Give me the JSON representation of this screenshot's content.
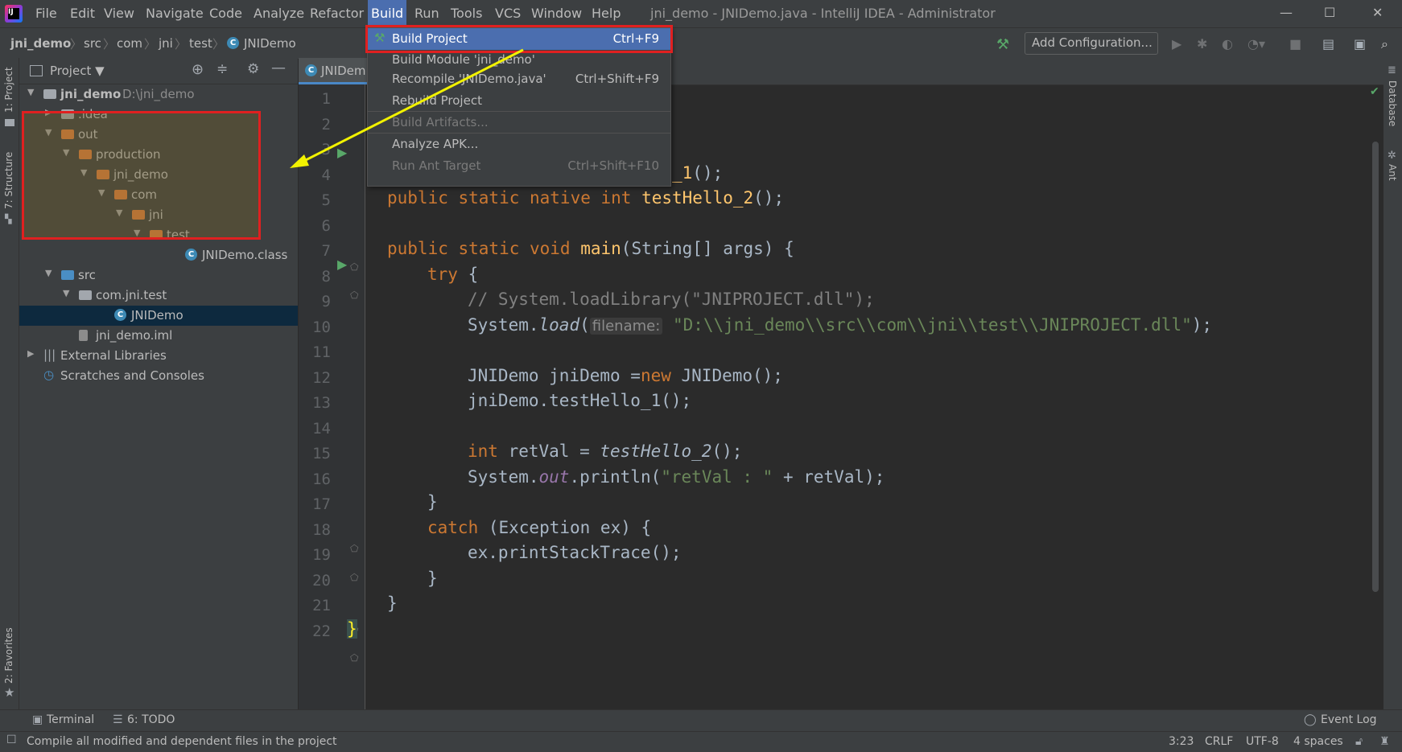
{
  "titlebar": {
    "app_icon": "intellij-icon",
    "menus": [
      "File",
      "Edit",
      "View",
      "Navigate",
      "Code",
      "Analyze",
      "Refactor",
      "Build",
      "Run",
      "Tools",
      "VCS",
      "Window",
      "Help"
    ],
    "active_menu": "Build",
    "title": "jni_demo - JNIDemo.java - IntelliJ IDEA - Administrator",
    "controls": [
      "—",
      "☐",
      "✕"
    ]
  },
  "navbar": {
    "breadcrumbs": [
      "jni_demo",
      "src",
      "com",
      "jni",
      "test",
      "JNIDemo"
    ],
    "add_configuration": "Add Configuration..."
  },
  "left_strip": {
    "project_tab": "1: Project",
    "structure_tab": "7: Structure",
    "favorites_tab": "2: Favorites"
  },
  "right_strip": {
    "database_tab": "Database",
    "ant_tab": "Ant"
  },
  "project_panel": {
    "header": "Project ▼",
    "tree": [
      {
        "label": "jni_demo",
        "extra": "D:\\jni_demo",
        "indent": 0,
        "arrow": "▼",
        "icon": "module",
        "bold": true
      },
      {
        "label": ".idea",
        "indent": 1,
        "arrow": "▶",
        "icon": "folder-gray"
      },
      {
        "label": "out",
        "indent": 1,
        "arrow": "▼",
        "icon": "folder-orange"
      },
      {
        "label": "production",
        "indent": 2,
        "arrow": "▼",
        "icon": "folder-orange"
      },
      {
        "label": "jni_demo",
        "indent": 3,
        "arrow": "▼",
        "icon": "folder-orange"
      },
      {
        "label": "com",
        "indent": 4,
        "arrow": "▼",
        "icon": "folder-orange"
      },
      {
        "label": "jni",
        "indent": 5,
        "arrow": "▼",
        "icon": "folder-orange"
      },
      {
        "label": "test",
        "indent": 6,
        "arrow": "▼",
        "icon": "folder-orange"
      },
      {
        "label": "JNIDemo.class",
        "indent": 8,
        "arrow": "",
        "icon": "class"
      },
      {
        "label": "src",
        "indent": 1,
        "arrow": "▼",
        "icon": "folder-blue"
      },
      {
        "label": "com.jni.test",
        "indent": 2,
        "arrow": "▼",
        "icon": "package"
      },
      {
        "label": "JNIDemo",
        "indent": 4,
        "arrow": "",
        "icon": "class",
        "selected": true
      },
      {
        "label": "jni_demo.iml",
        "indent": 2,
        "arrow": "",
        "icon": "file"
      },
      {
        "label": "External Libraries",
        "indent": 0,
        "arrow": "▶",
        "icon": "libraries"
      },
      {
        "label": "Scratches and Consoles",
        "indent": 0,
        "arrow": "",
        "icon": "scratches"
      }
    ]
  },
  "editor": {
    "tab_label": "JNIDem",
    "line_numbers": [
      "1",
      "2",
      "3",
      "4",
      "5",
      "6",
      "7",
      "8",
      "9",
      "10",
      "11",
      "12",
      "13",
      "14",
      "15",
      "16",
      "17",
      "18",
      "19",
      "20",
      "21",
      "22"
    ]
  },
  "build_menu": {
    "items": [
      {
        "label": "Build Project",
        "shortcut": "Ctrl+F9",
        "selected": true,
        "disabled": false
      },
      {
        "label": "Build Module 'jni_demo'",
        "shortcut": "",
        "selected": false,
        "disabled": false
      },
      {
        "label": "Recompile 'JNIDemo.java'",
        "shortcut": "Ctrl+Shift+F9",
        "selected": false,
        "disabled": false
      },
      {
        "label": "Rebuild Project",
        "shortcut": "",
        "selected": false,
        "disabled": false
      },
      {
        "label": "Build Artifacts...",
        "shortcut": "",
        "selected": false,
        "disabled": true
      },
      {
        "label": "Analyze APK...",
        "shortcut": "",
        "selected": false,
        "disabled": false
      },
      {
        "label": "Run Ant Target",
        "shortcut": "Ctrl+Shift+F10",
        "selected": false,
        "disabled": true
      }
    ]
  },
  "toolwindows": {
    "terminal": "Terminal",
    "todo": "6: TODO",
    "event_log": "Event Log"
  },
  "statusbar": {
    "message": "Compile all modified and dependent files in the project",
    "position": "3:23",
    "line_sep": "CRLF",
    "encoding": "UTF-8",
    "indent": "4 spaces"
  },
  "colors": {
    "accent": "#4b6eaf",
    "annotation_red": "#e02020",
    "annotation_arrow": "#f2f200"
  }
}
